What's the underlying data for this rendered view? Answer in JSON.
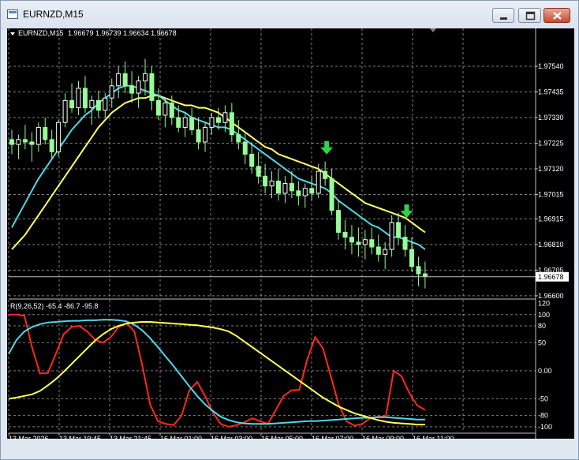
{
  "window": {
    "title": "EURNZD,M15",
    "buttons": {
      "minimize_icon": "minimize-icon",
      "restore_icon": "restore-icon",
      "close_icon": "close-icon"
    }
  },
  "chart_data": [
    {
      "type": "candlestick",
      "title": "EURNZD,M15",
      "ohlc_label": "1.96679 1.96739 1.96634 1.96678",
      "current_price": "1.96678",
      "y_ticks": [
        "1.97540",
        "1.97435",
        "1.97330",
        "1.97225",
        "1.97120",
        "1.97015",
        "1.96915",
        "1.96810",
        "1.96705",
        "1.96600"
      ],
      "ylim": [
        1.9659,
        1.9765
      ],
      "x_ticks": [
        "13 Mar 2026",
        "13 Mar 19:45",
        "13 Mar 21:45",
        "16 Mar 01:00",
        "16 Mar 03:00",
        "16 Mar 05:00",
        "16 Mar 07:00",
        "16 Mar 09:00",
        "16 Mar 11:00"
      ],
      "colors": {
        "bull": "#ffffff",
        "bear": "#98fb98",
        "fast_ma": "#4fd7e8",
        "slow_ma": "#ffff66",
        "arrow": "#2fd34a",
        "grid": "#a9a9a9",
        "background": "#000000"
      },
      "candles": [
        [
          1.9724,
          1.9728,
          1.9718,
          1.9722
        ],
        [
          1.9722,
          1.9726,
          1.9716,
          1.9724
        ],
        [
          1.9724,
          1.973,
          1.972,
          1.9723
        ],
        [
          1.9723,
          1.9727,
          1.9715,
          1.9722
        ],
        [
          1.9722,
          1.9731,
          1.9719,
          1.9729
        ],
        [
          1.9729,
          1.9733,
          1.9722,
          1.9724
        ],
        [
          1.9724,
          1.9728,
          1.9716,
          1.9719
        ],
        [
          1.9719,
          1.9732,
          1.9717,
          1.9731
        ],
        [
          1.9731,
          1.9743,
          1.9729,
          1.974
        ],
        [
          1.974,
          1.9747,
          1.9735,
          1.9737
        ],
        [
          1.9737,
          1.9748,
          1.9734,
          1.9745
        ],
        [
          1.9745,
          1.975,
          1.9735,
          1.9737
        ],
        [
          1.9737,
          1.9742,
          1.973,
          1.974
        ],
        [
          1.974,
          1.9744,
          1.9733,
          1.9736
        ],
        [
          1.9736,
          1.9743,
          1.9733,
          1.9741
        ],
        [
          1.9741,
          1.9749,
          1.9737,
          1.9746
        ],
        [
          1.9746,
          1.9754,
          1.9741,
          1.9751
        ],
        [
          1.9751,
          1.9756,
          1.9743,
          1.9746
        ],
        [
          1.9746,
          1.9752,
          1.9739,
          1.9743
        ],
        [
          1.9743,
          1.975,
          1.9737,
          1.9748
        ],
        [
          1.9748,
          1.9757,
          1.9742,
          1.9751
        ],
        [
          1.9751,
          1.9754,
          1.9736,
          1.974
        ],
        [
          1.974,
          1.9745,
          1.9732,
          1.9734
        ],
        [
          1.9734,
          1.9741,
          1.9729,
          1.9739
        ],
        [
          1.9739,
          1.9742,
          1.973,
          1.9733
        ],
        [
          1.9733,
          1.9738,
          1.9727,
          1.9729
        ],
        [
          1.9729,
          1.9735,
          1.9725,
          1.9733
        ],
        [
          1.9733,
          1.9737,
          1.9726,
          1.9728
        ],
        [
          1.9728,
          1.9733,
          1.972,
          1.9723
        ],
        [
          1.9723,
          1.9731,
          1.9719,
          1.9729
        ],
        [
          1.9729,
          1.9735,
          1.9726,
          1.9733
        ],
        [
          1.9733,
          1.9737,
          1.9728,
          1.9731
        ],
        [
          1.9731,
          1.9738,
          1.9727,
          1.9735
        ],
        [
          1.9735,
          1.9739,
          1.9723,
          1.9726
        ],
        [
          1.9726,
          1.9732,
          1.972,
          1.9723
        ],
        [
          1.9723,
          1.9727,
          1.9714,
          1.9718
        ],
        [
          1.9718,
          1.9723,
          1.971,
          1.9713
        ],
        [
          1.9713,
          1.9719,
          1.9706,
          1.9709
        ],
        [
          1.9709,
          1.9714,
          1.9702,
          1.9705
        ],
        [
          1.9705,
          1.9711,
          1.97,
          1.9707
        ],
        [
          1.9707,
          1.9712,
          1.9699,
          1.9702
        ],
        [
          1.9702,
          1.9709,
          1.9698,
          1.9706
        ],
        [
          1.9706,
          1.9711,
          1.97,
          1.9703
        ],
        [
          1.9703,
          1.9707,
          1.9697,
          1.9701
        ],
        [
          1.9701,
          1.9706,
          1.9696,
          1.9704
        ],
        [
          1.9704,
          1.9709,
          1.9699,
          1.9702
        ],
        [
          1.9702,
          1.9714,
          1.97,
          1.9711
        ],
        [
          1.9711,
          1.9715,
          1.9705,
          1.9708
        ],
        [
          1.9708,
          1.9712,
          1.9693,
          1.9695
        ],
        [
          1.9695,
          1.9699,
          1.9683,
          1.9686
        ],
        [
          1.9686,
          1.9691,
          1.9679,
          1.9684
        ],
        [
          1.9684,
          1.9689,
          1.9677,
          1.9682
        ],
        [
          1.9682,
          1.9688,
          1.9676,
          1.9681
        ],
        [
          1.9681,
          1.9687,
          1.9675,
          1.9683
        ],
        [
          1.9683,
          1.9688,
          1.9677,
          1.968
        ],
        [
          1.968,
          1.9685,
          1.9674,
          1.9677
        ],
        [
          1.9677,
          1.9682,
          1.9671,
          1.9679
        ],
        [
          1.9679,
          1.9693,
          1.9676,
          1.969
        ],
        [
          1.969,
          1.9694,
          1.9681,
          1.9684
        ],
        [
          1.9684,
          1.9689,
          1.9676,
          1.9679
        ],
        [
          1.9679,
          1.9684,
          1.967,
          1.9672
        ],
        [
          1.9672,
          1.9676,
          1.9664,
          1.9669
        ],
        [
          1.9669,
          1.9674,
          1.9663,
          1.9668
        ]
      ],
      "fast_ma": [
        1.9688,
        1.9693,
        1.9698,
        1.9703,
        1.9708,
        1.9712,
        1.9716,
        1.972,
        1.9724,
        1.9728,
        1.9731,
        1.9734,
        1.9736,
        1.9739,
        1.9741,
        1.9743,
        1.9745,
        1.9746,
        1.9746,
        1.9745,
        1.9744,
        1.9743,
        1.9742,
        1.974,
        1.9738,
        1.9736,
        1.9735,
        1.9733,
        1.9732,
        1.9731,
        1.973,
        1.9729,
        1.9729,
        1.9728,
        1.9726,
        1.9724,
        1.9722,
        1.972,
        1.9718,
        1.9716,
        1.9714,
        1.9712,
        1.971,
        1.9708,
        1.9707,
        1.9706,
        1.9705,
        1.9704,
        1.9702,
        1.9699,
        1.9697,
        1.9695,
        1.9693,
        1.9691,
        1.9689,
        1.9688,
        1.9686,
        1.9684,
        1.9684,
        1.9683,
        1.9682,
        1.9681,
        1.9679
      ],
      "slow_ma": [
        1.9679,
        1.9682,
        1.9685,
        1.9689,
        1.9693,
        1.9697,
        1.9701,
        1.9705,
        1.9709,
        1.9713,
        1.9717,
        1.9721,
        1.9725,
        1.9729,
        1.9732,
        1.9735,
        1.9737,
        1.9739,
        1.974,
        1.9741,
        1.9741,
        1.9742,
        1.9742,
        1.9741,
        1.974,
        1.9739,
        1.9738,
        1.9738,
        1.9737,
        1.9737,
        1.9736,
        1.9735,
        1.9733,
        1.9731,
        1.9729,
        1.9727,
        1.9725,
        1.9723,
        1.9721,
        1.972,
        1.9718,
        1.9717,
        1.9716,
        1.9715,
        1.9714,
        1.9713,
        1.9712,
        1.971,
        1.9708,
        1.9706,
        1.9704,
        1.9702,
        1.97,
        1.9698,
        1.9697,
        1.9696,
        1.9695,
        1.9694,
        1.9693,
        1.9692,
        1.969,
        1.9688,
        1.9686
      ],
      "signal_arrows": [
        47,
        59
      ]
    },
    {
      "type": "line",
      "indicator_label": "R(9,26,52) -65.4 -86.7 -95.8",
      "y_ticks": [
        "120",
        "100",
        "80",
        "50",
        "0.00",
        "-50",
        "-80",
        "-100"
      ],
      "ylim": [
        -110,
        125
      ],
      "series": [
        {
          "color": "#ff2a1a",
          "values": [
            100,
            100,
            98,
            40,
            -5,
            -4,
            30,
            65,
            78,
            80,
            70,
            55,
            50,
            60,
            78,
            85,
            70,
            10,
            -60,
            -90,
            -95,
            -97,
            -80,
            -35,
            -20,
            -45,
            -75,
            -95,
            -100,
            -97,
            -92,
            -85,
            -90,
            -95,
            -70,
            -45,
            -35,
            -34,
            20,
            60,
            40,
            -10,
            -60,
            -90,
            -98,
            -95,
            -85,
            -82,
            -82,
            0,
            -10,
            -40,
            -62,
            -70
          ]
        },
        {
          "color": "#4fd7e8",
          "values": [
            30,
            55,
            70,
            78,
            83,
            86,
            87,
            88,
            89,
            89,
            90,
            90,
            91,
            91,
            90,
            88,
            82,
            72,
            58,
            42,
            25,
            8,
            -10,
            -28,
            -45,
            -60,
            -72,
            -82,
            -88,
            -92,
            -94,
            -95,
            -95,
            -95,
            -94,
            -93,
            -92,
            -91,
            -90,
            -90,
            -89,
            -88,
            -87,
            -86,
            -85,
            -84,
            -84,
            -83,
            -83,
            -84,
            -85,
            -86,
            -87,
            -87
          ]
        },
        {
          "color": "#ffff55",
          "values": [
            -50,
            -48,
            -45,
            -42,
            -36,
            -26,
            -15,
            -2,
            12,
            26,
            40,
            54,
            65,
            74,
            80,
            84,
            86,
            87,
            87,
            86,
            85,
            84,
            83,
            82,
            81,
            79,
            77,
            74,
            70,
            62,
            52,
            42,
            32,
            22,
            12,
            2,
            -8,
            -18,
            -28,
            -38,
            -48,
            -56,
            -64,
            -70,
            -76,
            -80,
            -84,
            -88,
            -91,
            -93,
            -94,
            -95,
            -96,
            -96
          ]
        }
      ]
    }
  ]
}
